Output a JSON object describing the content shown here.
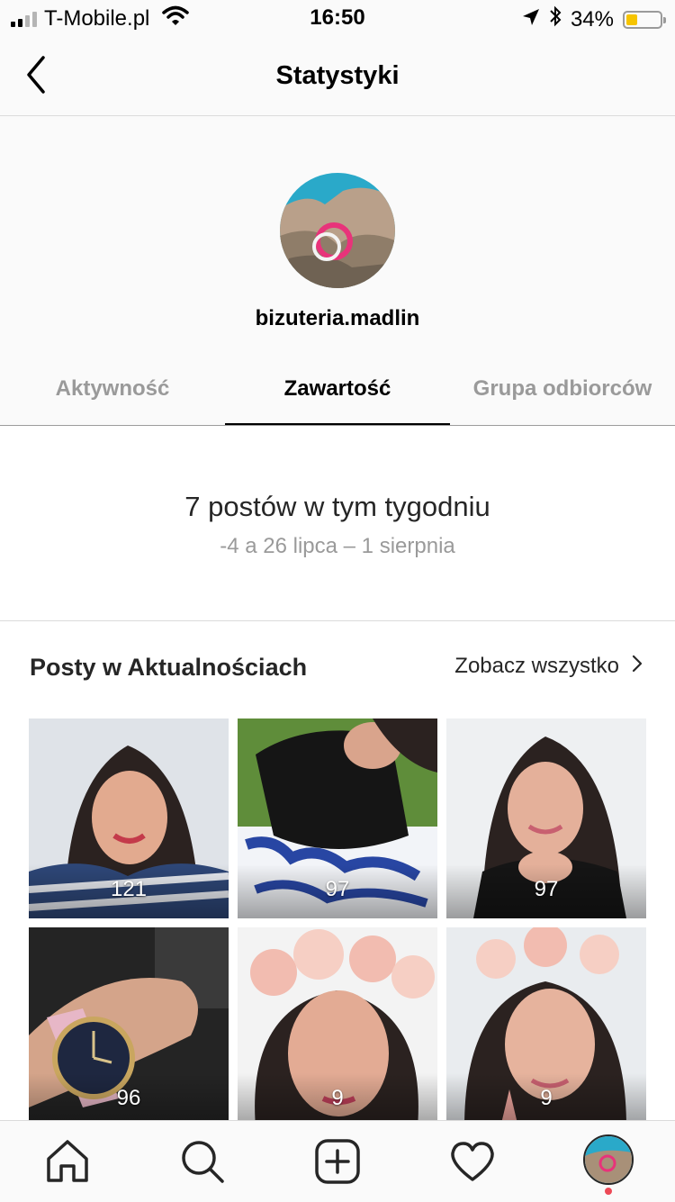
{
  "status_bar": {
    "carrier": "T-Mobile.pl",
    "time": "16:50",
    "battery_percent": "34%",
    "battery_level": 0.34,
    "icons": [
      "signal-icon",
      "wifi-icon",
      "location-arrow-icon",
      "bluetooth-icon",
      "battery-icon"
    ]
  },
  "nav": {
    "title": "Statystyki",
    "back_icon": "chevron-left-icon"
  },
  "profile": {
    "username": "bizuteria.madlin"
  },
  "tabs": [
    {
      "label": "Aktywność",
      "active": false
    },
    {
      "label": "Zawartość",
      "active": true
    },
    {
      "label": "Grupa odbiorców",
      "active": false
    }
  ],
  "summary": {
    "main": "7 postów w tym tygodniu",
    "sub": "-4 a 26 lipca – 1 sierpnia"
  },
  "posts_section": {
    "title": "Posty w Aktualnościach",
    "see_all": "Zobacz wszystko",
    "posts": [
      {
        "count": "121"
      },
      {
        "count": "97"
      },
      {
        "count": "97"
      },
      {
        "count": "96"
      },
      {
        "count": "9"
      },
      {
        "count": "9"
      }
    ]
  },
  "tabbar": {
    "items": [
      "home-icon",
      "search-icon",
      "add-post-icon",
      "heart-icon",
      "profile-avatar"
    ],
    "accent": "#ed4956"
  }
}
